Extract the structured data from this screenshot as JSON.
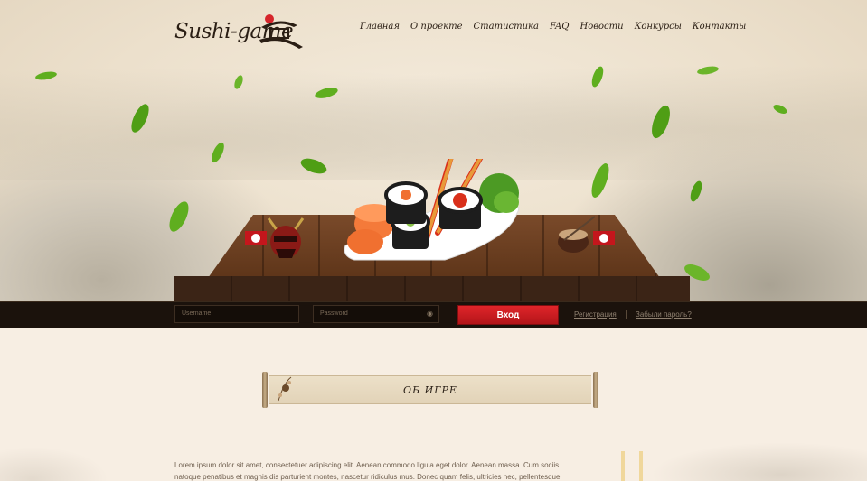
{
  "brand": {
    "logo_text": "Sushi-game"
  },
  "nav": {
    "items": [
      {
        "label": "Главная"
      },
      {
        "label": "О проекте"
      },
      {
        "label": "Статистика"
      },
      {
        "label": "FAQ"
      },
      {
        "label": "Новости"
      },
      {
        "label": "Конкурсы"
      },
      {
        "label": "Контакты"
      }
    ]
  },
  "login": {
    "username_placeholder": "Username",
    "password_placeholder": "Password",
    "submit_label": "Вход",
    "register_label": "Регистрация",
    "forgot_label": "Забыли пароль?"
  },
  "about": {
    "title": "ОБ ИГРЕ",
    "text": "Lorem ipsum dolor sit amet, consectetuer adipiscing elit. Aenean commodo ligula eget dolor. Aenean massa. Cum sociis natoque penatibus et magnis dis parturient montes, nascetur ridiculus mus. Donec quam felis, ultricies nec, pellentesque eu,"
  },
  "colors": {
    "accent": "#c4161c",
    "bar": "#1b120c",
    "leaf": "#5fae1f"
  },
  "icons": [
    "samurai-mask-icon",
    "soy-bowl-icon",
    "eye-icon",
    "bird-icon",
    "pagoda-roof-icon"
  ]
}
